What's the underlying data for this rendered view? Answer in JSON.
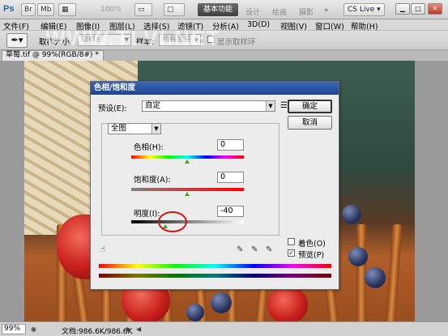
{
  "app": {
    "logo": "Ps",
    "zoom": "100%",
    "workspaces": [
      "基本功能",
      "设计",
      "绘画",
      "摄影"
    ],
    "more": "»",
    "cs_live": "CS Live",
    "window_controls": [
      "▁",
      "□",
      "✕"
    ]
  },
  "menu": [
    "文件(F)",
    "编辑(E)",
    "图像(I)",
    "图层(L)",
    "选择(S)",
    "滤镜(T)",
    "分析(A)",
    "3D(D)",
    "视图(V)",
    "窗口(W)",
    "帮助(H)"
  ],
  "options": {
    "sample_size_label": "取样大小:",
    "sample_size_value": "取样点",
    "sample_label": "样本:",
    "sample_value": "所有图层",
    "show_ring_label": "显示取样环"
  },
  "watermark": "WWW.TLVI.NET",
  "document": {
    "tab_title": "草莓.tif @ 99%(RGB/8#) *",
    "tab_close": "×"
  },
  "dialog": {
    "title": "色相/饱和度",
    "preset_label": "预设(E):",
    "preset_value": "自定",
    "ok": "确定",
    "cancel": "取消",
    "channel_value": "全图",
    "hue_label": "色相(H):",
    "hue_value": "0",
    "saturation_label": "饱和度(A):",
    "saturation_value": "0",
    "lightness_label": "明度(I):",
    "lightness_value": "-40",
    "colorize_label": "着色(O)",
    "colorize_checked": false,
    "preview_label": "预览(P)",
    "preview_checked": true,
    "hue_slider_position": 0.5,
    "saturation_slider_position": 0.5,
    "lightness_slider_position": 0.3
  },
  "status": {
    "zoom": "99%",
    "doc_info": "文档:986.6K/986.6K"
  },
  "colors": {
    "dialog_title": "#2a55a8",
    "slider_thumb": "#4b9f2a",
    "highlight_circle": "#d21515"
  }
}
